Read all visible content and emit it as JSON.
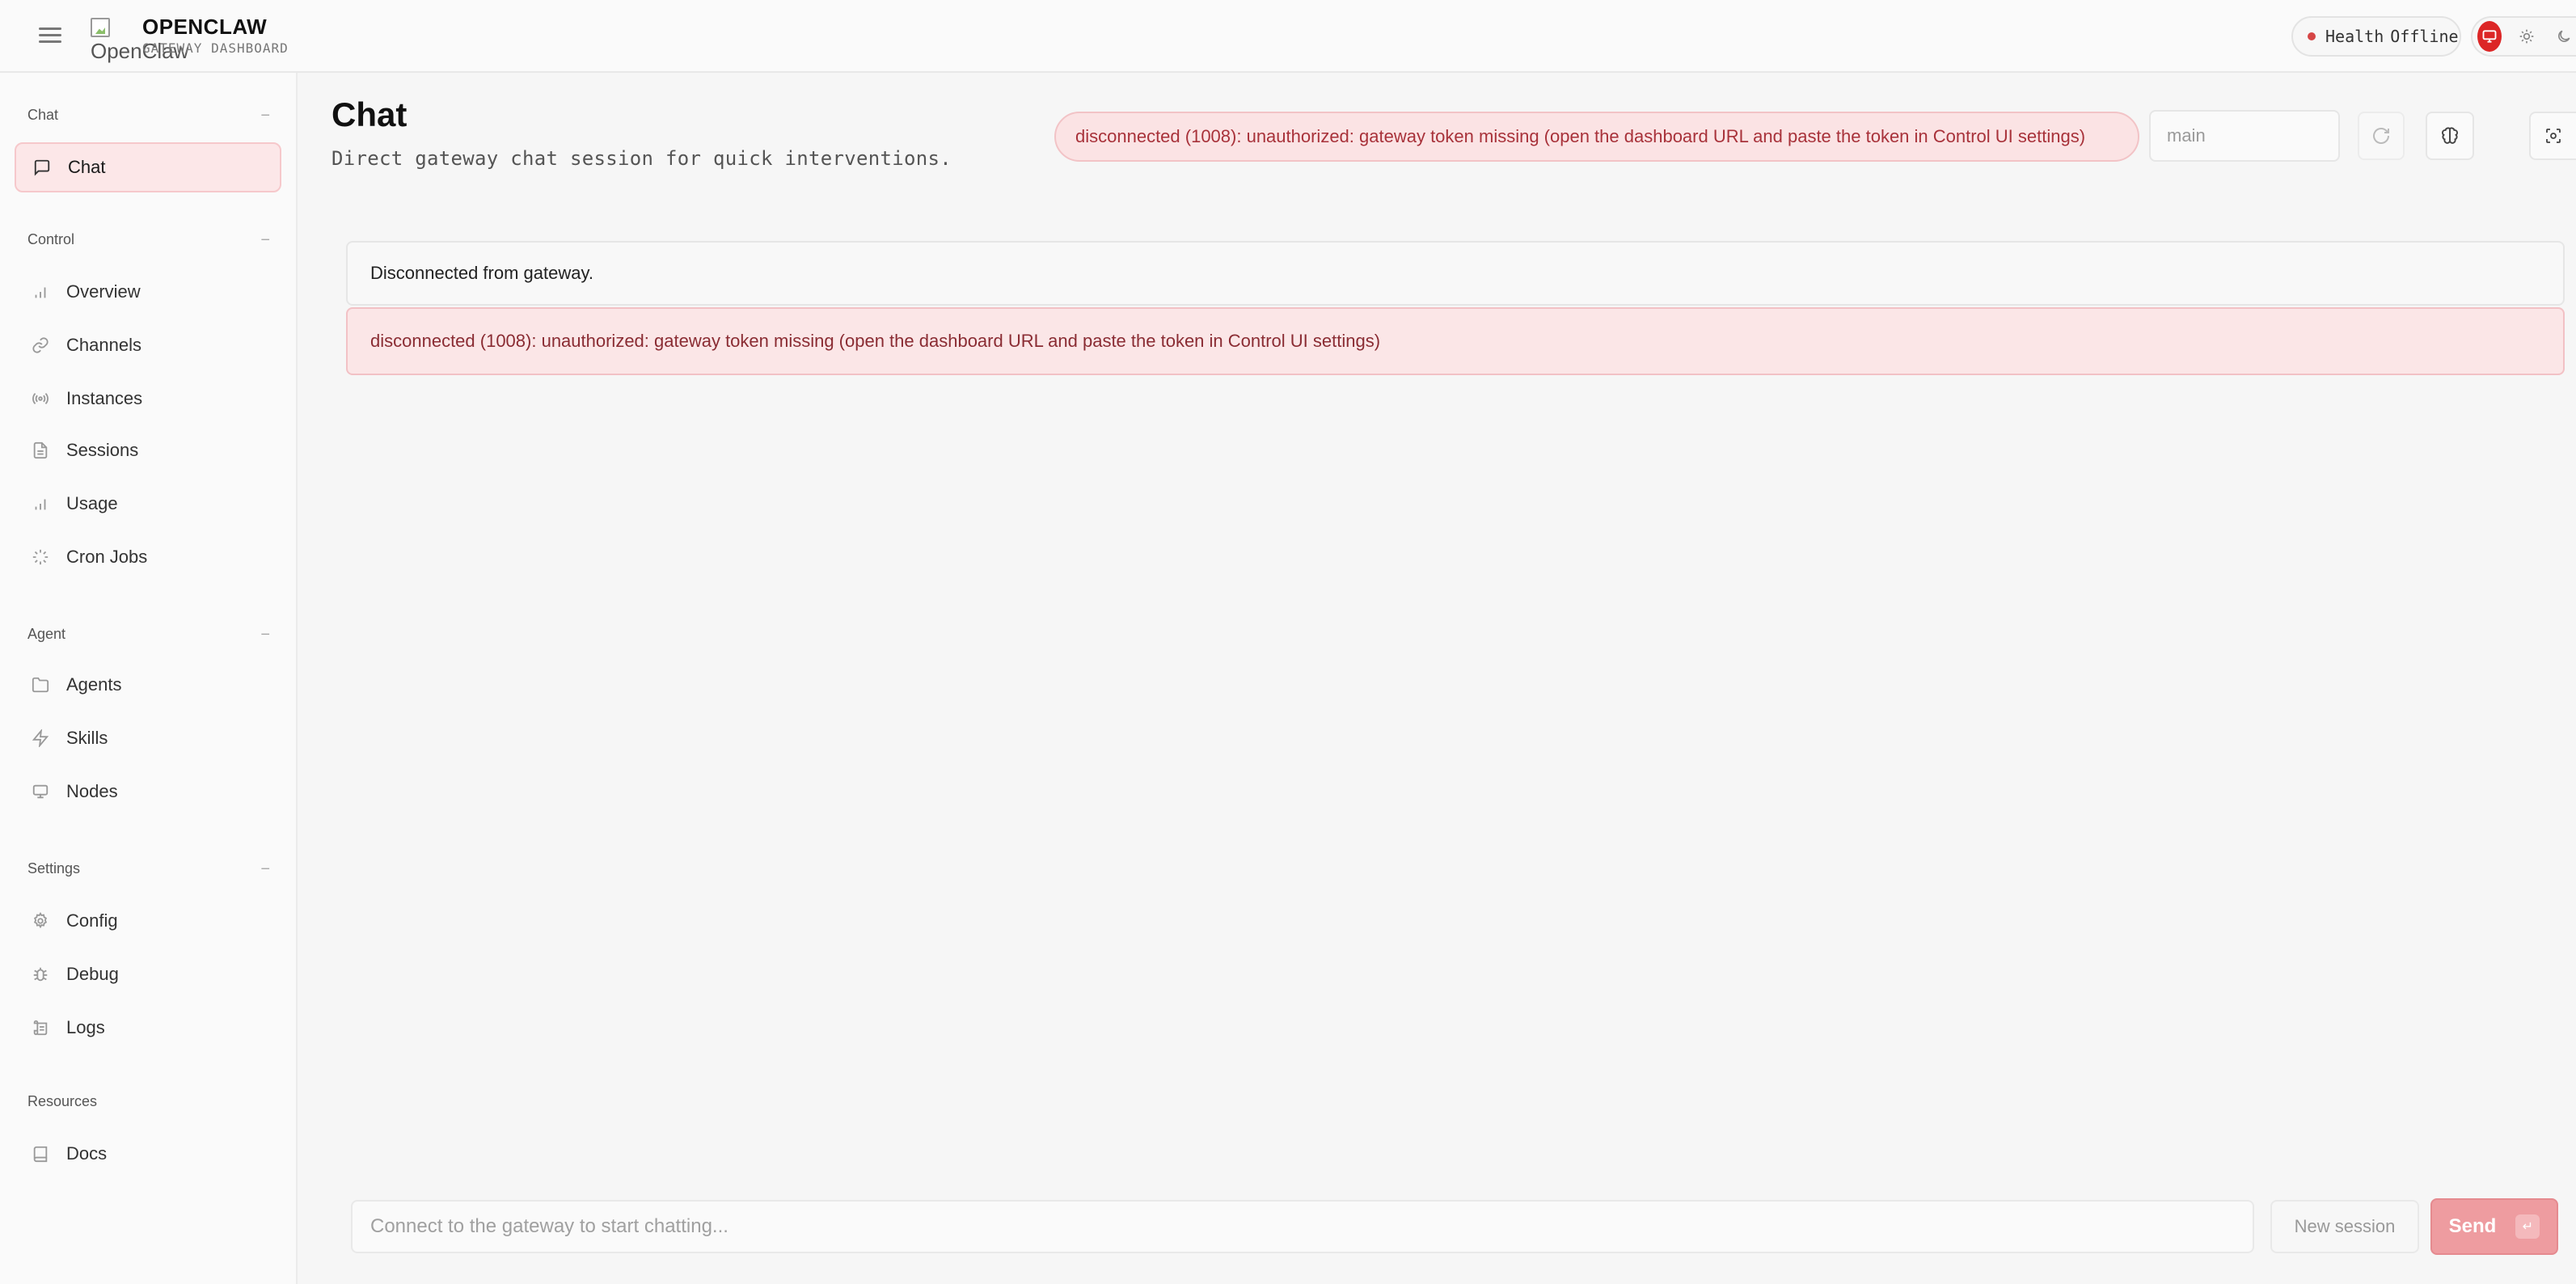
{
  "brand": {
    "logo_alt": "OpenClaw",
    "title": "OPENCLAW",
    "subtitle": "GATEWAY DASHBOARD"
  },
  "header": {
    "health_label": "Health",
    "health_status": "Offline"
  },
  "sidebar": {
    "sections": [
      {
        "label": "Chat",
        "collapse": "−"
      },
      {
        "label": "Control",
        "collapse": "−"
      },
      {
        "label": "Agent",
        "collapse": "−"
      },
      {
        "label": "Settings",
        "collapse": "−"
      },
      {
        "label": "Resources"
      }
    ],
    "items": [
      {
        "label": "Chat",
        "icon": "message-square-icon",
        "active": true
      },
      {
        "label": "Overview",
        "icon": "bar-chart-icon"
      },
      {
        "label": "Channels",
        "icon": "link-icon"
      },
      {
        "label": "Instances",
        "icon": "radio-icon"
      },
      {
        "label": "Sessions",
        "icon": "file-text-icon"
      },
      {
        "label": "Usage",
        "icon": "bar-chart-icon"
      },
      {
        "label": "Cron Jobs",
        "icon": "loader-icon"
      },
      {
        "label": "Agents",
        "icon": "folder-icon"
      },
      {
        "label": "Skills",
        "icon": "zap-icon"
      },
      {
        "label": "Nodes",
        "icon": "monitor-icon"
      },
      {
        "label": "Config",
        "icon": "settings-icon"
      },
      {
        "label": "Debug",
        "icon": "bug-icon"
      },
      {
        "label": "Logs",
        "icon": "scroll-icon"
      },
      {
        "label": "Docs",
        "icon": "book-icon"
      }
    ]
  },
  "main": {
    "title": "Chat",
    "description": "Direct gateway chat session for quick interventions.",
    "error_banner": "disconnected (1008): unauthorized: gateway token missing (open the dashboard URL and paste the token in Control UI settings)",
    "session_placeholder": "main",
    "messages": [
      {
        "type": "info",
        "text": "Disconnected from gateway."
      },
      {
        "type": "error",
        "text": "disconnected (1008): unauthorized: gateway token missing (open the dashboard URL and paste the token in Control UI settings)"
      }
    ]
  },
  "composer": {
    "placeholder": "Connect to the gateway to start chatting...",
    "new_session_label": "New session",
    "send_label": "Send",
    "send_kbd": "↵"
  },
  "colors": {
    "accent": "#dc2626",
    "error_bg": "#fbe3e4",
    "error_text": "#a8323a",
    "send_bg": "#ee9ca0",
    "active_item_bg": "#fce7e8"
  }
}
